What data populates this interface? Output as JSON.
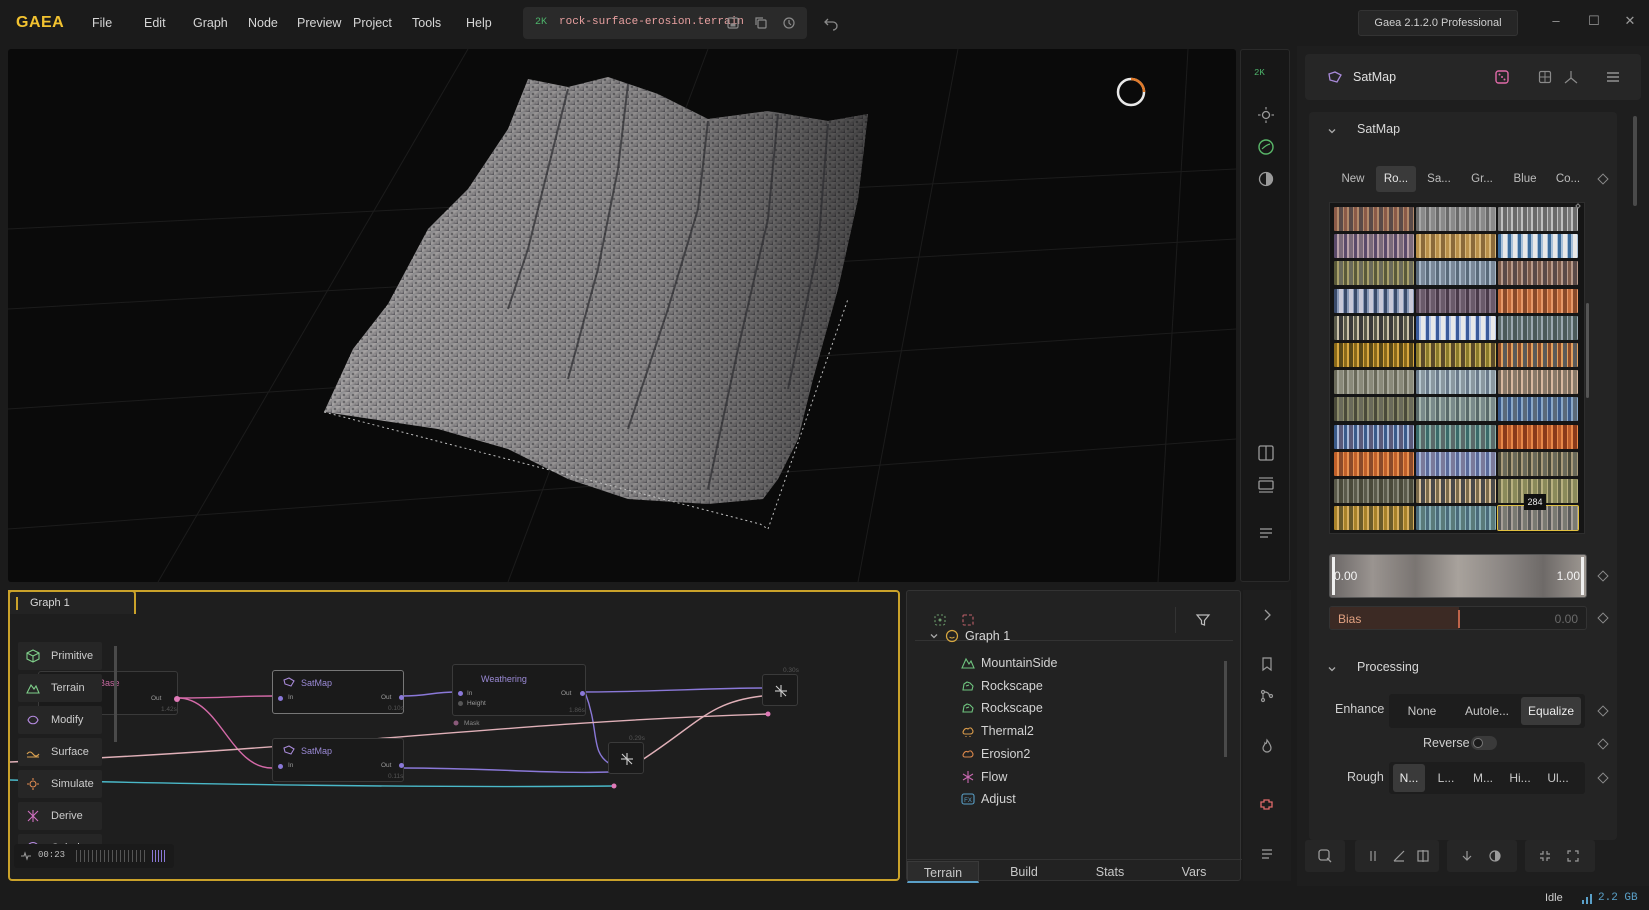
{
  "app": {
    "logo": "GAEA",
    "menu": [
      "File",
      "Edit",
      "Graph",
      "Node",
      "Preview",
      "Project",
      "Tools",
      "Help"
    ],
    "resolution_badge": "2K",
    "filename": "rock-surface-erosion.terrain",
    "version": "Gaea 2.1.2.0 Professional"
  },
  "viewport": {
    "resolution_badge": "2K"
  },
  "properties": {
    "node_name": "SatMap",
    "satmap_section": {
      "title": "SatMap",
      "tabs": [
        "New",
        "Ro...",
        "Sa...",
        "Gr...",
        "Blue",
        "Co..."
      ],
      "active_tab": "Ro...",
      "selected_index_badge": "284",
      "range_min": "0.00",
      "range_max": "1.00",
      "bias_label": "Bias",
      "bias_value": "0.00",
      "bias_fraction": 0.5
    },
    "processing_section": {
      "title": "Processing",
      "enhance_label": "Enhance",
      "enhance_options": [
        "None",
        "Autole...",
        "Equalize"
      ],
      "enhance_selected": "Equalize",
      "reverse_label": "Reverse",
      "reverse_on": false,
      "rough_label": "Rough",
      "rough_options": [
        "N...",
        "L...",
        "M...",
        "Hi...",
        "Ul..."
      ],
      "rough_selected": "N..."
    }
  },
  "graph": {
    "tab_label": "Graph 1",
    "categories": [
      {
        "label": "Primitive",
        "icon": "cube-icon",
        "color": "#7fcf8a"
      },
      {
        "label": "Terrain",
        "icon": "mountain-icon",
        "color": "#7fcf8a"
      },
      {
        "label": "Modify",
        "icon": "modify-icon",
        "color": "#b58ae0"
      },
      {
        "label": "Surface",
        "icon": "surface-icon",
        "color": "#d8a050"
      },
      {
        "label": "Simulate",
        "icon": "simulate-icon",
        "color": "#e08a50"
      },
      {
        "label": "Derive",
        "icon": "derive-icon",
        "color": "#d070c0"
      },
      {
        "label": "Colorize",
        "icon": "colorize-icon",
        "color": "#b58ae0"
      }
    ],
    "nodes": {
      "base": {
        "title": "Base",
        "port_out": "Out",
        "time": "1.42s"
      },
      "satmap1": {
        "title": "SatMap",
        "port_in": "In",
        "port_out": "Out",
        "time": "0.10s"
      },
      "satmap2": {
        "title": "SatMap",
        "port_in": "In",
        "port_out": "Out",
        "time": "0.11s"
      },
      "weathering": {
        "title": "Weathering",
        "port_in": "In",
        "port_height": "Height",
        "port_mask": "Mask",
        "port_out": "Out",
        "time": "1.86s"
      },
      "combine1": {
        "time": "0.29s"
      },
      "combine2": {
        "time": "0.30s"
      }
    },
    "timer": "00:23"
  },
  "layers": {
    "graph_name": "Graph 1",
    "items": [
      {
        "label": "MountainSide",
        "icon": "mountain-icon",
        "color": "#6fc47f"
      },
      {
        "label": "Rockscape",
        "icon": "rock-icon",
        "color": "#6fc47f"
      },
      {
        "label": "Rockscape",
        "icon": "rock-icon",
        "color": "#6fc47f"
      },
      {
        "label": "Thermal2",
        "icon": "thermal-icon",
        "color": "#d89a4a"
      },
      {
        "label": "Erosion2",
        "icon": "erosion-icon",
        "color": "#d8864a"
      },
      {
        "label": "Flow",
        "icon": "flow-icon",
        "color": "#c868b0"
      },
      {
        "label": "Adjust",
        "icon": "fx-icon",
        "color": "#5aa0c8"
      }
    ],
    "bottom_tabs": [
      "Terrain",
      "Build",
      "Stats",
      "Vars"
    ],
    "active_bottom_tab": "Terrain"
  },
  "status": {
    "state": "Idle",
    "memory": "2.2 GB"
  },
  "colors": {
    "accent_yellow": "#caa22a",
    "logo": "#f2c230",
    "wire_pink": "#d46aa8",
    "wire_purple": "#8a78d8",
    "wire_cyan": "#4ab8c8",
    "wire_beige": "#e0b0b8"
  }
}
